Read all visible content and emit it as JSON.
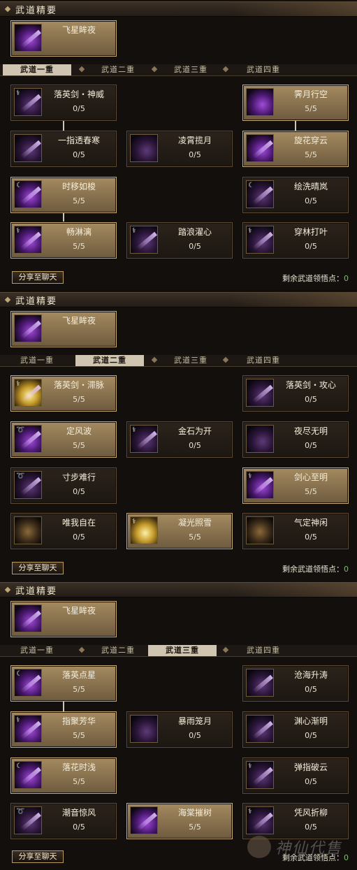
{
  "sections": [
    {
      "header": "武道精要",
      "essence": {
        "name": "飞星眸夜"
      },
      "tabs": [
        "武道一重",
        "武道二重",
        "武道三重",
        "武道四重"
      ],
      "active_tab": 0,
      "skills": [
        {
          "name": "落英剑・神威",
          "level": "0/5",
          "active": false,
          "icon": "sword-arc-icon"
        },
        {
          "name": "霁月行空",
          "level": "5/5",
          "active": true,
          "icon": "shadow-figure-icon"
        },
        {
          "name": "一指透春寒",
          "level": "0/5",
          "active": false,
          "icon": "finger-strike-icon"
        },
        {
          "name": "凌霄揽月",
          "level": "0/5",
          "active": false,
          "icon": "moon-grab-icon"
        },
        {
          "name": "旋花穿云",
          "level": "5/5",
          "active": true,
          "icon": "flower-spin-icon"
        },
        {
          "name": "时移如梭",
          "level": "5/5",
          "active": true,
          "icon": "time-shift-icon"
        },
        {
          "name": "绘洗晴岚",
          "level": "0/5",
          "active": false,
          "icon": "mist-wash-icon"
        },
        {
          "name": "畅淋漓",
          "level": "5/5",
          "active": true,
          "icon": "flowing-blade-icon"
        },
        {
          "name": "踏浪濯心",
          "level": "0/5",
          "active": false,
          "icon": "wave-step-icon"
        },
        {
          "name": "穿林打叶",
          "level": "0/5",
          "active": false,
          "icon": "leaf-strike-icon"
        }
      ],
      "share_label": "分享至聊天",
      "remain_label": "剩余武道领悟点：",
      "remain_value": "0"
    },
    {
      "header": "武道精要",
      "essence": {
        "name": "飞星眸夜"
      },
      "tabs": [
        "武道一重",
        "武道二重",
        "武道三重",
        "武道四重"
      ],
      "active_tab": 1,
      "skills": [
        {
          "name": "落英剑・滞脉",
          "level": "5/5",
          "active": true,
          "icon": "sword-arc-icon"
        },
        {
          "name": "落英剑・攻心",
          "level": "0/5",
          "active": false,
          "icon": "sword-arc-icon"
        },
        {
          "name": "定风波",
          "level": "5/5",
          "active": true,
          "icon": "wind-wave-icon"
        },
        {
          "name": "金石为开",
          "level": "0/5",
          "active": false,
          "icon": "stone-break-icon"
        },
        {
          "name": "夜尽无明",
          "level": "0/5",
          "active": false,
          "icon": "night-end-icon"
        },
        {
          "name": "寸步难行",
          "level": "0/5",
          "active": false,
          "icon": "slow-step-icon"
        },
        {
          "name": "剑心至明",
          "level": "5/5",
          "active": true,
          "icon": "sword-heart-icon"
        },
        {
          "name": "唯我自在",
          "level": "0/5",
          "active": false,
          "icon": "self-figure-icon"
        },
        {
          "name": "凝光照雪",
          "level": "5/5",
          "active": true,
          "icon": "light-snow-icon"
        },
        {
          "name": "气定神闲",
          "level": "0/5",
          "active": false,
          "icon": "calm-spirit-icon"
        }
      ],
      "share_label": "分享至聊天",
      "remain_label": "剩余武道领悟点：",
      "remain_value": "0"
    },
    {
      "header": "武道精要",
      "essence": {
        "name": "飞星眸夜"
      },
      "tabs": [
        "武道一重",
        "武道二重",
        "武道三重",
        "武道四重"
      ],
      "active_tab": 2,
      "skills": [
        {
          "name": "落英点星",
          "level": "5/5",
          "active": true,
          "icon": "star-point-icon"
        },
        {
          "name": "沧海升涛",
          "level": "0/5",
          "active": false,
          "icon": "sea-tide-icon"
        },
        {
          "name": "指聚芳华",
          "level": "5/5",
          "active": true,
          "icon": "finger-bloom-icon"
        },
        {
          "name": "暴雨笼月",
          "level": "0/5",
          "active": false,
          "icon": "storm-moon-icon"
        },
        {
          "name": "渊心渐明",
          "level": "0/5",
          "active": false,
          "icon": "abyss-heart-icon"
        },
        {
          "name": "落花时浅",
          "level": "5/5",
          "active": true,
          "icon": "falling-flower-icon"
        },
        {
          "name": "弹指破云",
          "level": "0/5",
          "active": false,
          "icon": "flick-cloud-icon"
        },
        {
          "name": "潮音惊风",
          "level": "0/5",
          "active": false,
          "icon": "tide-sound-icon"
        },
        {
          "name": "海棠摧树",
          "level": "5/5",
          "active": true,
          "icon": "begonia-icon"
        },
        {
          "name": "凭风折柳",
          "level": "0/5",
          "active": false,
          "icon": "willow-icon"
        }
      ],
      "share_label": "分享至聊天",
      "remain_label": "剩余武道领悟点：",
      "remain_value": "0"
    }
  ],
  "watermark": "神仙代售"
}
